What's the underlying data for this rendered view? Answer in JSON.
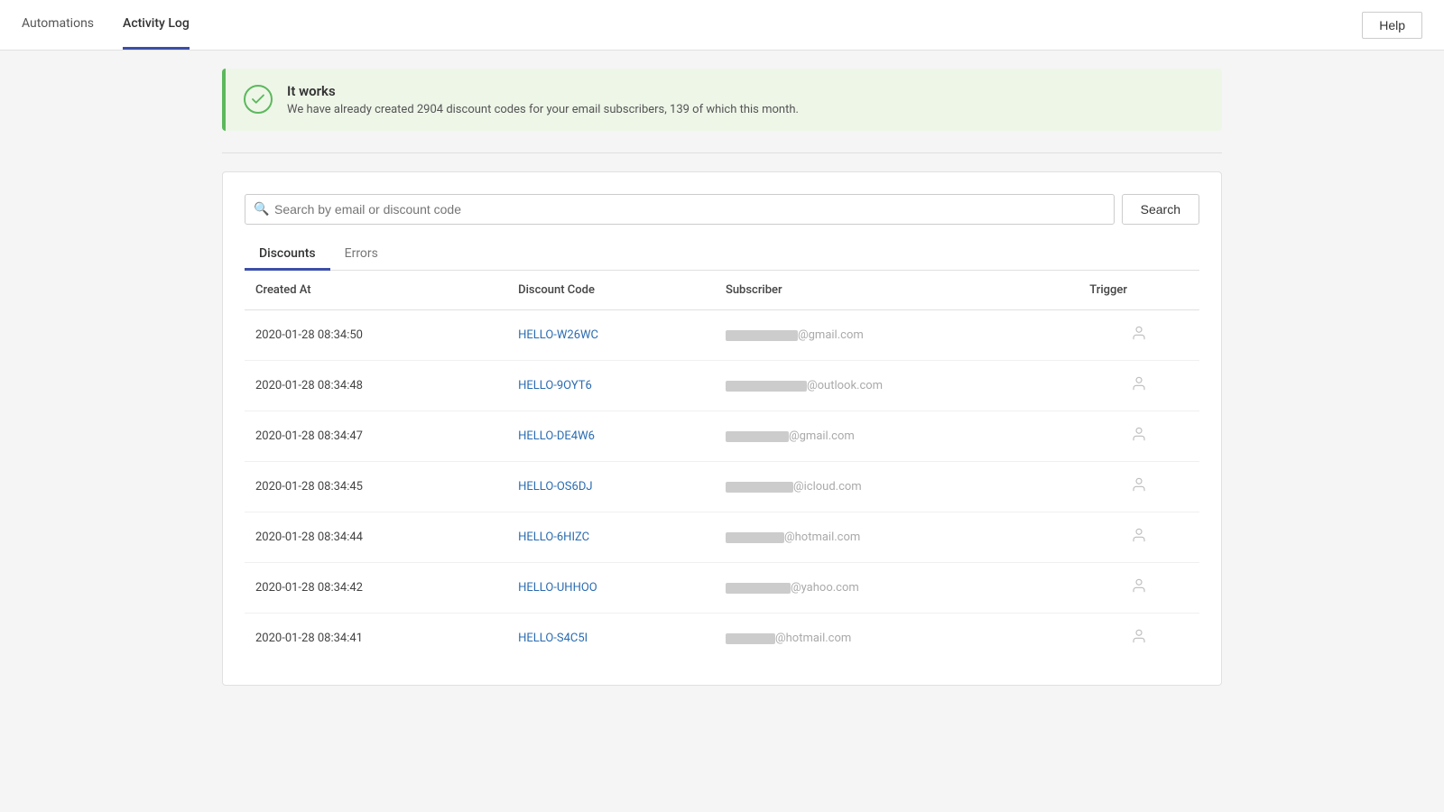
{
  "nav": {
    "items": [
      {
        "label": "Automations",
        "active": false
      },
      {
        "label": "Activity Log",
        "active": true
      }
    ],
    "help_label": "Help"
  },
  "banner": {
    "title": "It works",
    "message": "We have already created 2904 discount codes for your email subscribers, 139 of which this month."
  },
  "search": {
    "placeholder": "Search by email or discount code",
    "button_label": "Search",
    "value": ""
  },
  "tabs": [
    {
      "label": "Discounts",
      "active": true
    },
    {
      "label": "Errors",
      "active": false
    }
  ],
  "table": {
    "columns": [
      "Created At",
      "Discount Code",
      "Subscriber",
      "Trigger"
    ],
    "rows": [
      {
        "created_at": "2020-01-28 08:34:50",
        "discount_code": "HELLO-W26WC",
        "subscriber_domain": "@gmail.com",
        "subscriber_blur_width": "80"
      },
      {
        "created_at": "2020-01-28 08:34:48",
        "discount_code": "HELLO-9OYT6",
        "subscriber_domain": "@outlook.com",
        "subscriber_blur_width": "90"
      },
      {
        "created_at": "2020-01-28 08:34:47",
        "discount_code": "HELLO-DE4W6",
        "subscriber_domain": "@gmail.com",
        "subscriber_blur_width": "70"
      },
      {
        "created_at": "2020-01-28 08:34:45",
        "discount_code": "HELLO-OS6DJ",
        "subscriber_domain": "@icloud.com",
        "subscriber_blur_width": "75"
      },
      {
        "created_at": "2020-01-28 08:34:44",
        "discount_code": "HELLO-6HIZC",
        "subscriber_domain": "@hotmail.com",
        "subscriber_blur_width": "65"
      },
      {
        "created_at": "2020-01-28 08:34:42",
        "discount_code": "HELLO-UHHOO",
        "subscriber_domain": "@yahoo.com",
        "subscriber_blur_width": "72"
      },
      {
        "created_at": "2020-01-28 08:34:41",
        "discount_code": "HELLO-S4C5I",
        "subscriber_domain": "@hotmail.com",
        "subscriber_blur_width": "55"
      }
    ]
  }
}
